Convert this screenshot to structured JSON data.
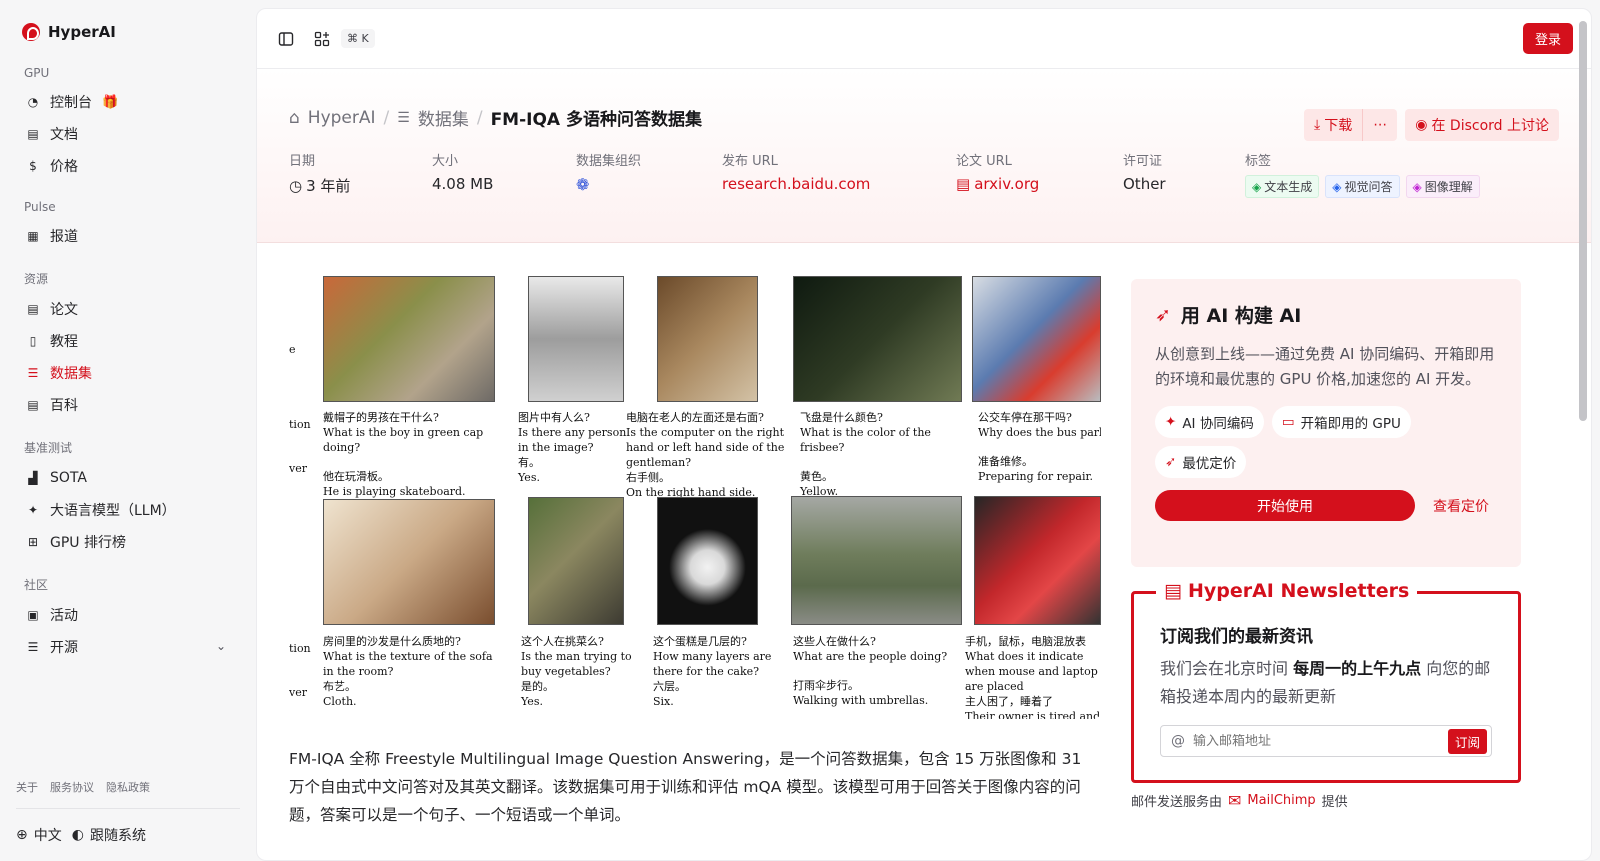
{
  "brand": "HyperAI",
  "sidebar": {
    "groups": [
      {
        "title": "GPU",
        "items": [
          "控制台",
          "文档",
          "价格"
        ]
      },
      {
        "title": "Pulse",
        "items": [
          "报道"
        ]
      },
      {
        "title": "资源",
        "items": [
          "论文",
          "教程",
          "数据集",
          "百科"
        ]
      },
      {
        "title": "基准测试",
        "items": [
          "SOTA",
          "大语言模型（LLM）",
          "GPU 排行榜"
        ]
      },
      {
        "title": "社区",
        "items": [
          "活动",
          "开源"
        ]
      }
    ],
    "footer_links": [
      "关于",
      "服务协议",
      "隐私政策"
    ],
    "language": "中文",
    "theme": "跟随系统"
  },
  "topbar": {
    "shortcut": "⌘ K",
    "login": "登录"
  },
  "breadcrumb": {
    "home": "HyperAI",
    "section": "数据集",
    "current": "FM-IQA 多语种问答数据集"
  },
  "actions": {
    "download": "下载",
    "more": "⋯",
    "discord": "在 Discord 上讨论"
  },
  "meta": {
    "date_label": "日期",
    "date_value": "3 年前",
    "size_label": "大小",
    "size_value": "4.08 MB",
    "org_label": "数据集组织",
    "url_label": "发布 URL",
    "url_value": "research.baidu.com",
    "paper_label": "论文 URL",
    "paper_value": "arxiv.org",
    "license_label": "许可证",
    "license_value": "Other",
    "tags_label": "标签",
    "tags": [
      "文本生成",
      "视觉问答",
      "图像理解"
    ]
  },
  "figure": {
    "row_labels": [
      "e",
      "tion",
      "ver",
      "tion",
      "ver"
    ],
    "row1": [
      {
        "zh_q": "戴帽子的男孩在干什么?",
        "en_q": "What is the boy in green cap doing?",
        "zh_a": "他在玩滑板。",
        "en_a": "He is playing skateboard."
      },
      {
        "zh_q": "图片中有人么?",
        "en_q": "Is there any person in the image?",
        "zh_a": "有。",
        "en_a": "Yes."
      },
      {
        "zh_q": "电脑在老人的左面还是右面?",
        "en_q": "Is the computer on the right hand or left hand side of the gentleman?",
        "zh_a": "右手侧。",
        "en_a": "On the right hand side."
      },
      {
        "zh_q": "飞盘是什么颜色?",
        "en_q": "What is the color of the frisbee?",
        "zh_a": "黄色。",
        "en_a": "Yellow."
      },
      {
        "zh_q": "公交车停在那干吗?",
        "en_q": "Why does the bus park th",
        "zh_a": "准备维修。",
        "en_a": "Preparing for repair."
      }
    ],
    "row2": [
      {
        "zh_q": "房间里的沙发是什么质地的?",
        "en_q": "What is the texture of the sofa in the room?",
        "zh_a": "布艺。",
        "en_a": "Cloth."
      },
      {
        "zh_q": "这个人在挑菜么?",
        "en_q": "Is the man trying to buy vegetables?",
        "zh_a": "是的。",
        "en_a": "Yes."
      },
      {
        "zh_q": "这个蛋糕是几层的?",
        "en_q": "How many layers are there for the cake?",
        "zh_a": "六层。",
        "en_a": "Six."
      },
      {
        "zh_q": "这些人在做什么?",
        "en_q": "What are the people doing?",
        "zh_a": "打雨伞步行。",
        "en_a": "Walking with umbrellas."
      },
      {
        "zh_q": "手机，鼠标，电脑混放表",
        "en_q": "What does it indicate when mouse and laptop are placed",
        "zh_a": "主人困了，睡着了",
        "en_a": "Their owner is tired and sle"
      }
    ]
  },
  "description": "FM-IQA 全称 Freestyle Multilingual Image Question Answering，是一个问答数据集，包含 15 万张图像和 31 万个自由式中文问答对及其英文翻译。该数据集可用于训练和评估 mQA 模型。该模型可用于回答关于图像内容的问题，答案可以是一个句子、一个短语或一个单词。",
  "ai_card": {
    "title": "用 AI 构建 AI",
    "text": "从创意到上线——通过免费 AI 协同编码、开箱即用的环境和最优惠的 GPU 价格,加速您的 AI 开发。",
    "chips": [
      "AI 协同编码",
      "开箱即用的 GPU",
      "最优定价"
    ],
    "start": "开始使用",
    "pricing": "查看定价"
  },
  "newsletter": {
    "title": "HyperAI Newsletters",
    "heading": "订阅我们的最新资讯",
    "text_pre": "我们会在北京时间 ",
    "text_bold": "每周一的上午九点",
    "text_post": " 向您的邮箱投递本周内的最新更新",
    "placeholder": "输入邮箱地址",
    "subscribe": "订阅",
    "provider_pre": "邮件发送服务由",
    "provider": "MailChimp",
    "provider_post": "提供"
  },
  "colors": {
    "accent": "#d4101c"
  }
}
